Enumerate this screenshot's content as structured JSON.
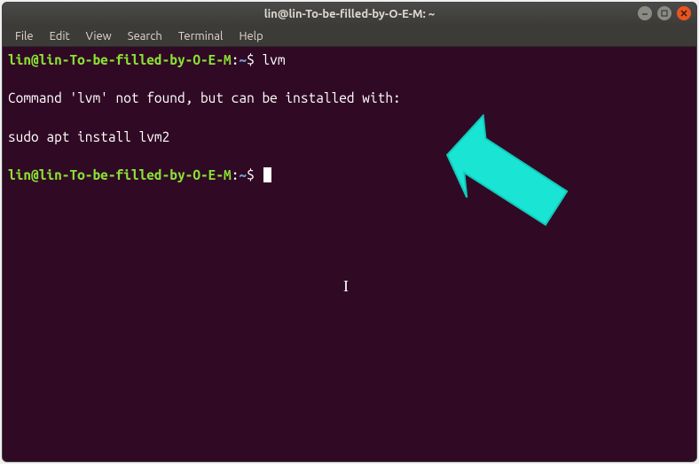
{
  "titlebar": {
    "title": "lin@lin-To-be-filled-by-O-E-M: ~"
  },
  "menubar": {
    "file": "File",
    "edit": "Edit",
    "view": "View",
    "search": "Search",
    "terminal": "Terminal",
    "help": "Help"
  },
  "terminal": {
    "prompt_user_host": "lin@lin-To-be-filled-by-O-E-M",
    "prompt_sep": ":",
    "prompt_path": "~",
    "prompt_dollar": "$",
    "cmd1": "lvm",
    "out_notfound": "Command 'lvm' not found, but can be installed with:",
    "out_install": "sudo apt install lvm2"
  }
}
